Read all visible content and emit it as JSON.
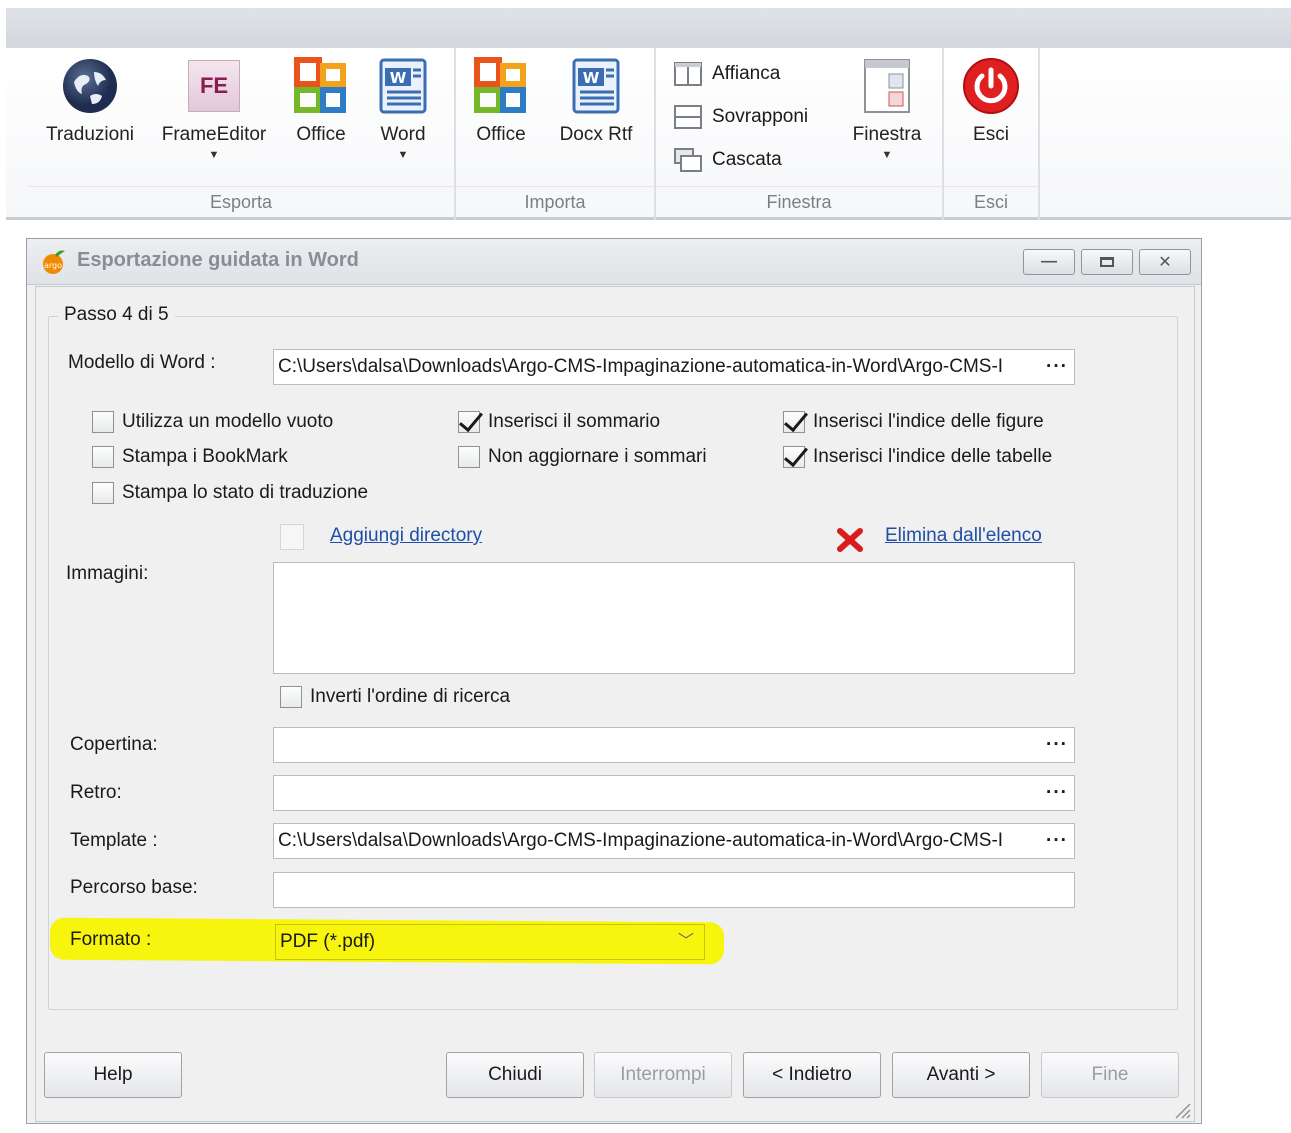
{
  "ribbon": {
    "groups": {
      "esporta": "Esporta",
      "importa": "Importa",
      "finestra": "Finestra",
      "esci": "Esci"
    },
    "buttons": {
      "traduzioni": "Traduzioni",
      "frameeditor": "FrameEditor",
      "office_export": "Office",
      "word": "Word",
      "office_import": "Office",
      "docx_rtf": "Docx Rtf",
      "affianca": "Affianca",
      "sovrapponi": "Sovrapponi",
      "cascata": "Cascata",
      "finestra": "Finestra",
      "esci": "Esci"
    },
    "fe_text": "FE"
  },
  "dialog": {
    "title": "Esportazione guidata in Word",
    "step": "Passo 4 di 5",
    "modello_label": "Modello di Word :",
    "modello_value": "C:\\Users\\dalsa\\Downloads\\Argo-CMS-Impaginazione-automatica-in-Word\\Argo-CMS-I",
    "checkboxes": {
      "modello_vuoto": "Utilizza un modello vuoto",
      "stampa_bookmark": "Stampa i BookMark",
      "stampa_stato": "Stampa lo stato di traduzione",
      "inserisci_sommario": "Inserisci il sommario",
      "non_aggiornare": "Non aggiornare i sommari",
      "indice_figure": "Inserisci l'indice delle figure",
      "indice_tabelle": "Inserisci l'indice delle tabelle",
      "inverti_ordine": "Inverti l'ordine di ricerca"
    },
    "aggiungi_directory": "Aggiungi directory",
    "elimina_elenco": "Elimina dall'elenco",
    "immagini_label": "Immagini:",
    "copertina_label": "Copertina:",
    "retro_label": "Retro:",
    "template_label": "Template :",
    "template_value": "C:\\Users\\dalsa\\Downloads\\Argo-CMS-Impaginazione-automatica-in-Word\\Argo-CMS-I",
    "percorso_label": "Percorso base:",
    "formato_label": "Formato :",
    "formato_value": "PDF (*.pdf)",
    "ellipsis": "···"
  },
  "buttons": {
    "help": "Help",
    "chiudi": "Chiudi",
    "interrompi": "Interrompi",
    "indietro": "< Indietro",
    "avanti": "Avanti >",
    "fine": "Fine"
  },
  "colors": {
    "highlight": "#f7f400",
    "link": "#1f4fa5",
    "esci_red": "#e02020"
  }
}
